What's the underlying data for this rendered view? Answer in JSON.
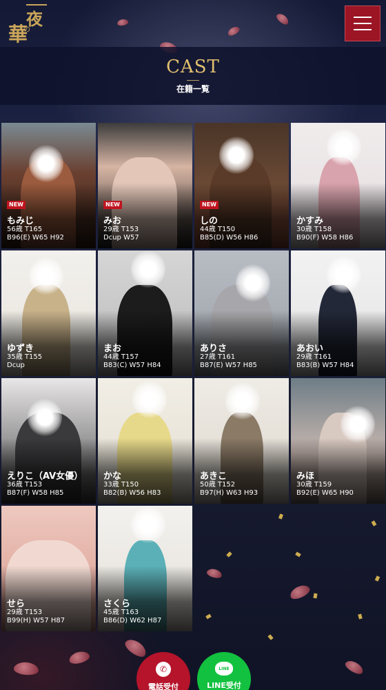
{
  "header": {
    "logo_char_1": "華",
    "logo_char_2": "夜",
    "logo_char_small": "の",
    "menu_icon": "hamburger-icon"
  },
  "page": {
    "title": "CAST",
    "subtitle": "在籍一覧"
  },
  "colors": {
    "accent_gold": "#e3c16f",
    "menu_red": "#9b1525",
    "new_badge": "#c0141f",
    "line_green": "#12c13f",
    "tel_red": "#b5142a"
  },
  "cast": [
    {
      "name": "もみじ",
      "new": "NEW",
      "line1": "56歳 T165",
      "line2": "B96(E) W65 H92"
    },
    {
      "name": "みお",
      "new": "NEW",
      "line1": "29歳 T153",
      "line2": "Dcup W57"
    },
    {
      "name": "しの",
      "new": "NEW",
      "line1": "44歳 T150",
      "line2": "B85(D) W56 H86"
    },
    {
      "name": "かすみ",
      "new": "",
      "line1": "30歳 T158",
      "line2": "B90(F) W58 H86"
    },
    {
      "name": "ゆずき",
      "new": "",
      "line1": "35歳 T155",
      "line2": "Dcup"
    },
    {
      "name": "まお",
      "new": "",
      "line1": "44歳 T157",
      "line2": "B83(C) W57 H84"
    },
    {
      "name": "ありさ",
      "new": "",
      "line1": "27歳 T161",
      "line2": "B87(E) W57 H85"
    },
    {
      "name": "あおい",
      "new": "",
      "line1": "29歳 T161",
      "line2": "B83(B) W57 H84"
    },
    {
      "name": "えりこ（AV女優）",
      "new": "",
      "line1": "36歳 T153",
      "line2": "B87(F) W58 H85"
    },
    {
      "name": "かな",
      "new": "",
      "line1": "33歳 T150",
      "line2": "B82(B) W56 H83"
    },
    {
      "name": "あきこ",
      "new": "",
      "line1": "50歳 T152",
      "line2": "B97(H) W63 H93"
    },
    {
      "name": "みほ",
      "new": "",
      "line1": "30歳 T159",
      "line2": "B92(E) W65 H90"
    },
    {
      "name": "せら",
      "new": "",
      "line1": "29歳 T153",
      "line2": "B99(H) W57 H87"
    },
    {
      "name": "さくら",
      "new": "",
      "line1": "45歳 T163",
      "line2": "B86(D) W62 H87"
    }
  ],
  "footer": {
    "tel_label": "電話受付",
    "tel_icon": "phone-icon",
    "line_label": "LINE受付",
    "line_icon_text": "LINE"
  }
}
